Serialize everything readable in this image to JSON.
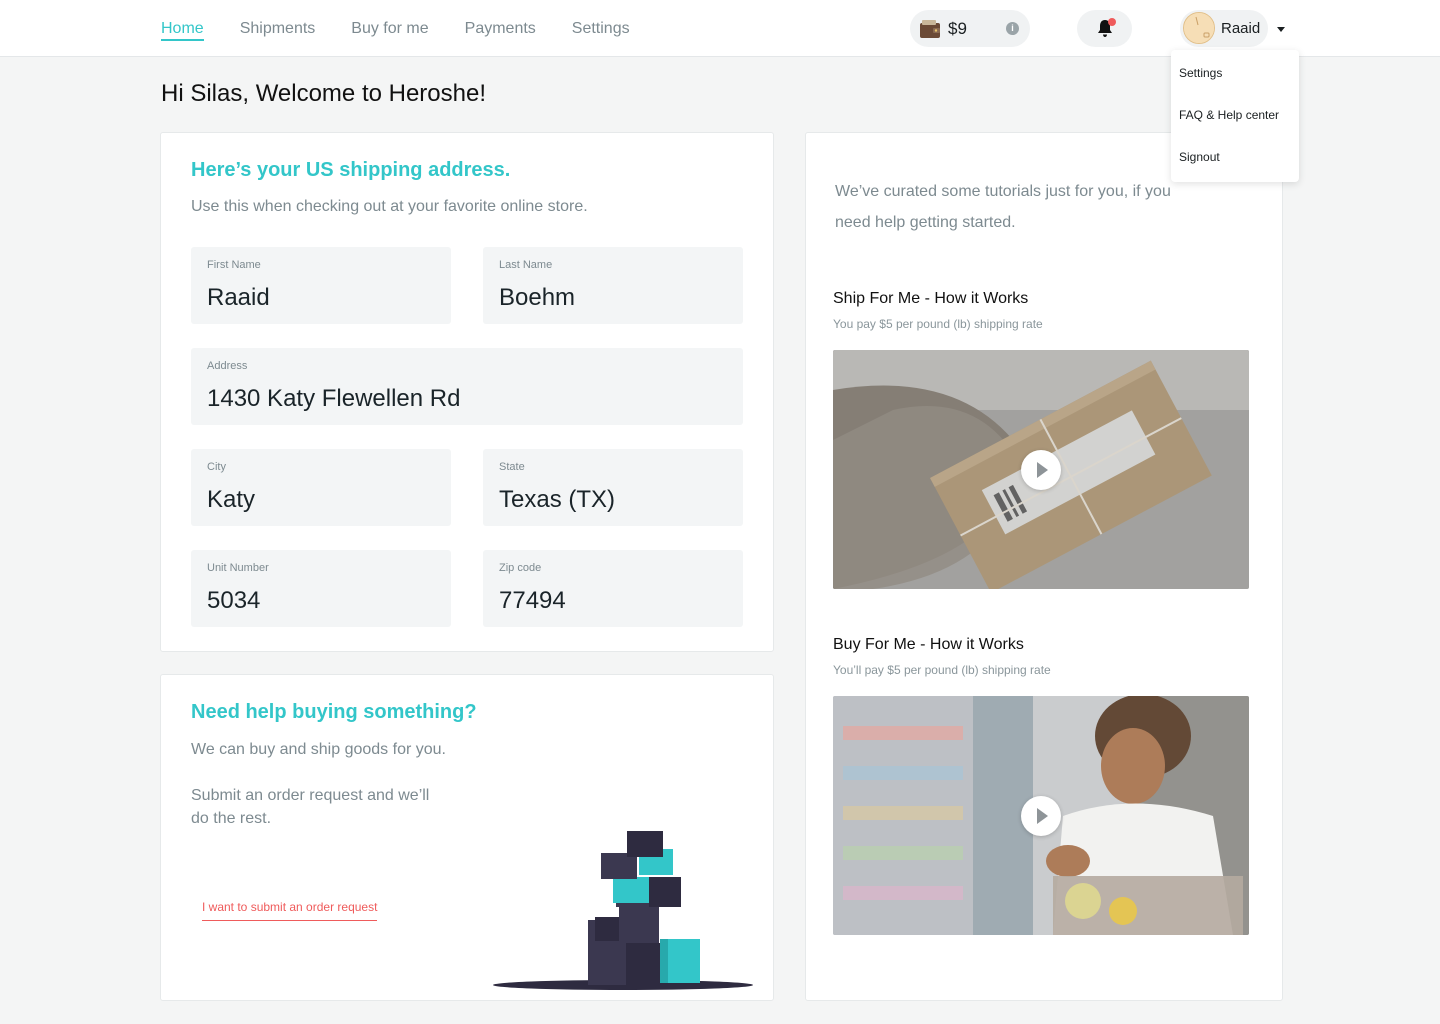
{
  "nav": {
    "items": [
      {
        "label": "Home",
        "active": true
      },
      {
        "label": "Shipments",
        "active": false
      },
      {
        "label": "Buy for me",
        "active": false
      },
      {
        "label": "Payments",
        "active": false
      },
      {
        "label": "Settings",
        "active": false
      }
    ]
  },
  "wallet": {
    "amount": "$9",
    "icon": "wallet-icon",
    "info_icon": "info-icon"
  },
  "notifications": {
    "icon": "bell-icon",
    "has_unread": true
  },
  "user": {
    "name": "Raaid",
    "avatar_icon": "avatar"
  },
  "user_menu": {
    "items": [
      "Settings",
      "FAQ & Help center",
      "Signout"
    ]
  },
  "greeting": "Hi Silas, Welcome to Heroshe!",
  "address_card": {
    "title": "Here’s your US shipping address.",
    "subtitle": "Use this  when checking out at your favorite online store.",
    "fields": {
      "first_name": {
        "label": "First Name",
        "value": "Raaid"
      },
      "last_name": {
        "label": "Last Name",
        "value": "Boehm"
      },
      "address": {
        "label": "Address",
        "value": "1430 Katy Flewellen Rd"
      },
      "city": {
        "label": "City",
        "value": "Katy"
      },
      "state": {
        "label": "State",
        "value": "Texas (TX)"
      },
      "unit": {
        "label": "Unit Number",
        "value": "5034"
      },
      "zip": {
        "label": "Zip code",
        "value": "77494"
      }
    }
  },
  "buy_card": {
    "title": "Need help buying something?",
    "line1": "We can buy and ship goods for you.",
    "line2a": "Submit an order request and we’ll",
    "line2b": "do the rest.",
    "link": "I want to submit an order request"
  },
  "tutorials": {
    "intro_a": "We’ve curated some tutorials just for you, if you",
    "intro_b": "need help getting started.",
    "items": [
      {
        "title": "Ship For Me - How it Works",
        "subtitle": "You pay $5 per pound (lb) shipping rate"
      },
      {
        "title": "Buy For Me - How it Works",
        "subtitle": "You’ll pay $5 per pound (lb) shipping rate"
      }
    ]
  },
  "colors": {
    "accent": "#33c6c9",
    "link": "#ef5b5b",
    "muted": "#7d8a90",
    "background": "#f4f5f5"
  }
}
